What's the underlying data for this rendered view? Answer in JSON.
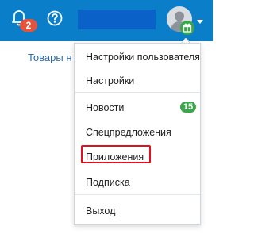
{
  "header": {
    "notifications_count": "2",
    "icons": [
      "bell-icon",
      "help-icon",
      "avatar-icon",
      "gift-icon",
      "caret-down-icon"
    ],
    "accent_color": "#0b7ec9"
  },
  "page": {
    "link_text": "Товары н"
  },
  "menu": {
    "items": [
      {
        "label": "Настройки пользователя"
      },
      {
        "label": "Настройки"
      },
      {
        "label": "Новости",
        "badge": "15"
      },
      {
        "label": "Спецпредложения"
      },
      {
        "label": "Приложения",
        "highlighted": true
      },
      {
        "label": "Подписка"
      },
      {
        "label": "Выход"
      }
    ],
    "highlight_color": "#e2101e",
    "badge_color": "#3aa54a"
  }
}
